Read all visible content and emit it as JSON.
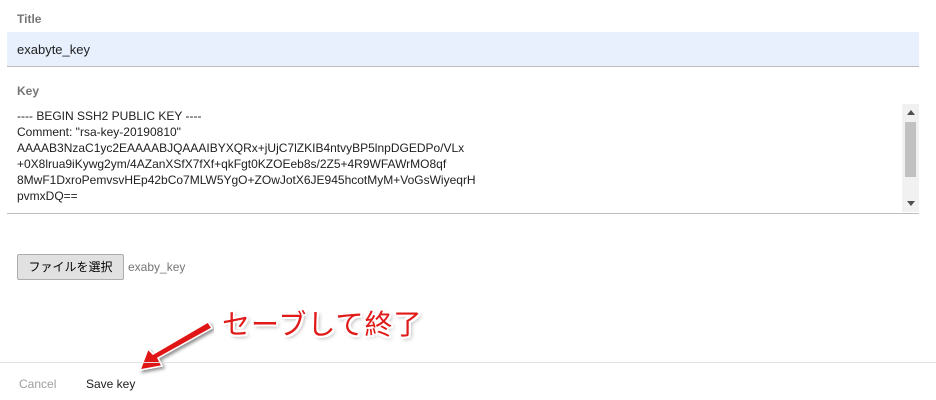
{
  "form": {
    "title_label": "Title",
    "title_value": "exabyte_key",
    "key_label": "Key",
    "key_value": "---- BEGIN SSH2 PUBLIC KEY ----\nComment: \"rsa-key-20190810\"\nAAAAB3NzaC1yc2EAAAABJQAAAIBYXQRx+jUjC7lZKIB4ntvyBP5lnpDGEDPo/VLx\n+0X8lrua9iKywg2ym/4AZanXSfX7fXf+qkFgt0KZOEeb8s/2Z5+4R9WFAWrMO8qf\n8MwF1DxroPemvsvHEp42bCo7MLW5YgO+ZOwJotX6JE945hcotMyM+VoGsWiyeqrH\npvmxDQ==",
    "file_button_label": "ファイルを選択",
    "file_name": "exaby_key"
  },
  "annotation": {
    "text": "セーブして終了",
    "color": "#e01919"
  },
  "footer": {
    "cancel_label": "Cancel",
    "save_label": "Save key"
  },
  "icons": {
    "scroll_up": "scroll-up-arrow-icon",
    "scroll_down": "scroll-down-arrow-icon",
    "annotation_arrow": "red-arrow-icon"
  }
}
